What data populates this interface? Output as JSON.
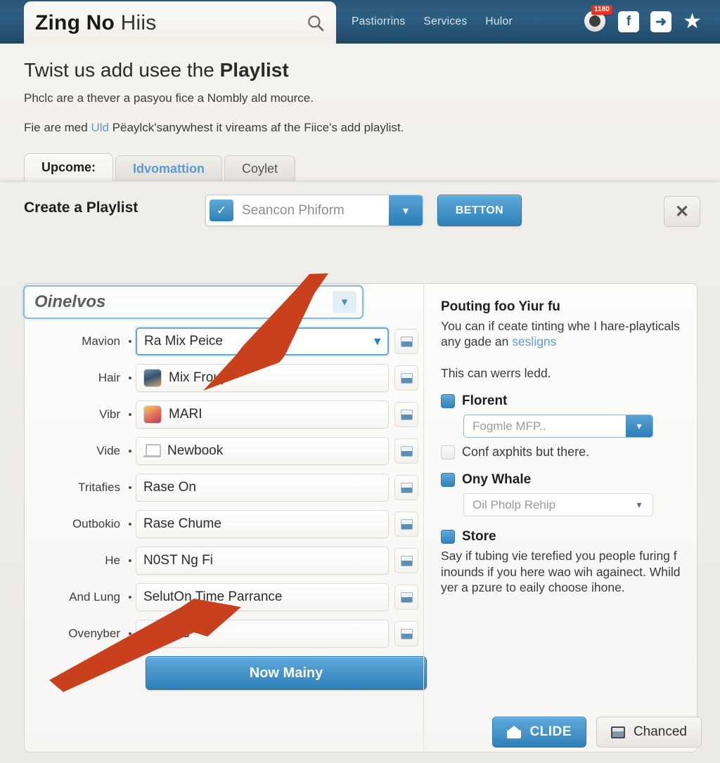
{
  "topbar": {
    "search": {
      "title_bold": "Zing No",
      "title_light": "Hiis",
      "icon": "search-icon"
    },
    "links": [
      {
        "label": "Pastiorrins"
      },
      {
        "label": "Services"
      },
      {
        "label": "Hulor"
      }
    ],
    "icons": [
      {
        "name": "account-icon",
        "badge": "1180"
      },
      {
        "name": "facebook-icon",
        "glyph": "f"
      },
      {
        "name": "share-arrow-icon",
        "glyph": "➜"
      },
      {
        "name": "star-icon",
        "glyph": "★"
      }
    ]
  },
  "intro": {
    "heading_plain": "Twist us add usee the ",
    "heading_bold": "Playlist",
    "paragraph1": "Phclc are a thever a pasyou fice a Nombly ald mource.",
    "p2_pre": "Fie are med ",
    "p2_link": "Uld",
    "p2_post": " Pëaylck'sаnywhest it vireams af the Fiice's add playlist."
  },
  "tabs": [
    {
      "label": "Upcome:",
      "state": "active"
    },
    {
      "label": "Idvomattion",
      "state": "link"
    },
    {
      "label": "Coylet",
      "state": "normal"
    }
  ],
  "dialog": {
    "title": "Create a Playlist",
    "head_select": {
      "checked": true,
      "value": "Seancon Phiform",
      "check_glyph": "✓",
      "arrow_glyph": "▾"
    },
    "head_button": "BETTON",
    "close_label": "✕",
    "big_select": {
      "value": "Oinelvos",
      "arrow_glyph": "▾"
    },
    "rows": [
      {
        "label": "Mavion",
        "value": "Ra Mix Peice",
        "thumb": "none",
        "focused": true,
        "has_arrow": true
      },
      {
        "label": "Hair",
        "value": "Mix Froup",
        "thumb": "photo1",
        "focused": false,
        "has_arrow": false
      },
      {
        "label": "Vibr",
        "value": "MARI",
        "thumb": "photo2",
        "focused": false,
        "has_arrow": false
      },
      {
        "label": "Vide",
        "value": "Newbook",
        "thumb": "laptop",
        "focused": false,
        "has_arrow": false
      },
      {
        "label": "Tritafies",
        "value": "Rase On",
        "thumb": "none",
        "focused": false,
        "has_arrow": false
      },
      {
        "label": "Outbokio",
        "value": "Rase Chume",
        "thumb": "none",
        "focused": false,
        "has_arrow": false
      },
      {
        "label": "He",
        "value": "N0ST Ng Fi",
        "thumb": "none",
        "focused": false,
        "has_arrow": false
      },
      {
        "label": "And Lung",
        "value": "SelutOn Time Parrance",
        "thumb": "none",
        "focused": false,
        "has_arrow": false
      },
      {
        "label": "Ovenyber",
        "value": "Jedgels",
        "thumb": "none",
        "focused": false,
        "has_arrow": false
      }
    ],
    "row_bullet": "•",
    "main_button": "Now Mainy",
    "right": {
      "heading": "Pouting foo Yiur fu",
      "desc_pre": "You can if ceate tinting whe I hare-playticals any gade an ",
      "desc_link": "sesligns",
      "note": "This can werrs ledd.",
      "option1": {
        "label": "Florent",
        "checked": true
      },
      "option1_select": {
        "value": "Fogmle MFP..",
        "arrow_glyph": "▾"
      },
      "option1_sub": {
        "label": "Conf axphits but there.",
        "checked": false
      },
      "option2": {
        "label": "Ony Whale",
        "checked": true
      },
      "option2_select": {
        "value": "Oil Pholp Rehip",
        "arrow_glyph": "▾"
      },
      "option3": {
        "label": "Store",
        "checked": true
      },
      "option3_text": "Say if tubing vie terefied you people furing f inounds if you here wao wih againect. Whild yer a pzure to eaily choose ihone."
    },
    "footer": {
      "primary": {
        "label": "CLIDE",
        "icon": "home-icon"
      },
      "secondary": {
        "label": "Chanced",
        "icon": "image-icon"
      }
    }
  },
  "colors": {
    "accent_blue": "#2f80ba",
    "nav_blue": "#2d5f83",
    "link_blue": "#5b9bd5",
    "arrow_red": "#c8411c",
    "badge_red": "#e2352a"
  }
}
